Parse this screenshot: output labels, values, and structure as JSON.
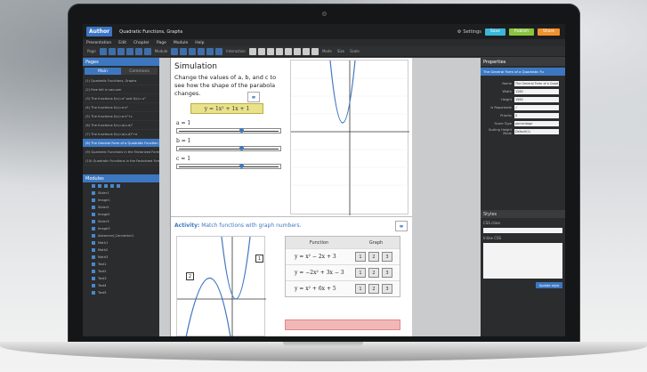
{
  "app": {
    "logo": "Author",
    "doc_title": "Quadratic Functions, Graphs",
    "settings": "Settings"
  },
  "top_buttons": [
    {
      "label": "Save",
      "color": "#39b7d6"
    },
    {
      "label": "Publish",
      "color": "#8bc53f"
    },
    {
      "label": "Share",
      "color": "#f0912d"
    }
  ],
  "menu": [
    "Presentation",
    "Edit",
    "Chapter",
    "Page",
    "Module",
    "Help"
  ],
  "toolbar_labels": [
    "Page",
    "Module",
    "Interaction",
    "Mode",
    "Size",
    "Scale"
  ],
  "left_panel": {
    "pages_title": "Pages",
    "tabs": [
      "Main",
      "Commons"
    ],
    "pages": [
      "(1) Quadratic Functions, Graphs",
      "(2) Free fall in vacuum",
      "(3) The functions f(x)=x² and f(x)=-x²",
      "(4) The functions f(x)=a·x²",
      "(5) The functions f(x)=a·x²+c",
      "(6) The functions f(x)=a(x-d)²",
      "(7) The functions f(x)=a(x-d)²+e",
      "(8) The General Form of a Quadratic Function",
      "(9) Quadratic Functions in the Factorized Form (1)",
      "(10) Quadratic Functions in the Factorized Form (2)"
    ],
    "active_page": 7,
    "modules_title": "Modules",
    "modules": [
      "Slider1",
      "Image1",
      "Slider2",
      "Image2",
      "Slider3",
      "Image3",
      "Advanced_Connector1",
      "Math1",
      "Math2",
      "Math3",
      "Text1",
      "Text2",
      "Text3",
      "Text4",
      "Text5"
    ]
  },
  "content": {
    "sim_title": "Simulation",
    "sim_text": "Change the values of a, b, and c to see how the shape of the parabola changes.",
    "formula": "y = 1x² + 1x + 1",
    "sliders": [
      {
        "label": "a = 1",
        "value": 0.6
      },
      {
        "label": "b = 1",
        "value": 0.6
      },
      {
        "label": "c = 1",
        "value": 0.6
      }
    ],
    "activity_bold": "Activity:",
    "activity_text": "Match functions with graph numbers.",
    "table_headers": [
      "Function",
      "Graph"
    ],
    "functions": [
      "y = x² − 2x + 3",
      "y = −2x² + 3x − 3",
      "y = x² + 6x + 5"
    ],
    "graph_buttons": [
      "1",
      "2",
      "3"
    ],
    "graph_labels": [
      "1",
      "2"
    ]
  },
  "right_panel": {
    "title": "Properties",
    "selected": "The General Form of a Quadratic Fu",
    "rows": [
      {
        "label": "Name",
        "value": "The General Form of a Quad"
      },
      {
        "label": "Width",
        "value": "1280"
      },
      {
        "label": "Height",
        "value": "1980"
      },
      {
        "label": "Is Reportable",
        "value": "✓"
      },
      {
        "label": "Priority",
        "value": "0"
      },
      {
        "label": "Score Type",
        "value": "percentage"
      },
      {
        "label": "Scaling Height Mode",
        "value": "Default(1)"
      }
    ],
    "styles_title": "Styles",
    "css_class": "CSS class",
    "inline_css": "Inline CSS",
    "update_btn": "Update style"
  }
}
